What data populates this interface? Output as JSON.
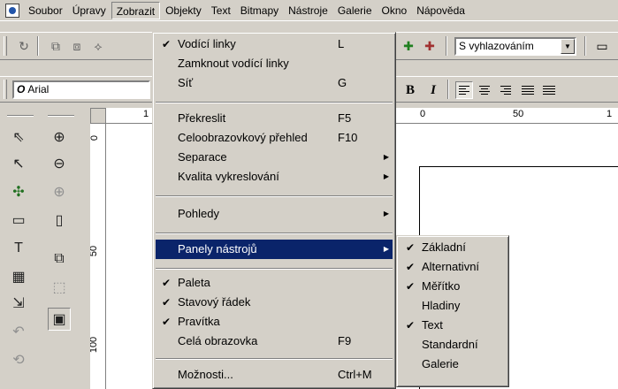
{
  "menubar": {
    "items": [
      "Soubor",
      "Úpravy",
      "Zobrazit",
      "Objekty",
      "Text",
      "Bitmapy",
      "Nástroje",
      "Galerie",
      "Okno",
      "Nápověda"
    ]
  },
  "toolbar": {
    "antialias_combo": "S vyhlazováním"
  },
  "format": {
    "font_combo": "Arial",
    "font_prefix": "O",
    "bold": "B",
    "italic": "I"
  },
  "ruler": {
    "h_labels": [
      "1",
      "0",
      "50",
      "1"
    ],
    "v_labels": [
      "0",
      "50",
      "100"
    ]
  },
  "zobrazit_menu": {
    "items": [
      {
        "label": "Vodící linky",
        "shortcut": "L",
        "checked": "✔"
      },
      {
        "label": "Zamknout vodící linky"
      },
      {
        "label": "Síť",
        "shortcut": "G"
      },
      {
        "label": "Překreslit",
        "shortcut": "F5"
      },
      {
        "label": "Celoobrazovkový přehled",
        "shortcut": "F10"
      },
      {
        "label": "Separace",
        "submenu": "▶"
      },
      {
        "label": "Kvalita vykreslování",
        "submenu": "▶"
      },
      {
        "label": "Pohledy",
        "submenu": "▶"
      },
      {
        "label": "Panely nástrojů",
        "submenu": "▶"
      },
      {
        "label": "Paleta",
        "checked": "✔"
      },
      {
        "label": "Stavový řádek",
        "checked": "✔"
      },
      {
        "label": "Pravítka",
        "checked": "✔"
      },
      {
        "label": "Celá obrazovka",
        "shortcut": "F9"
      },
      {
        "label": "Možnosti...",
        "shortcut": "Ctrl+M"
      }
    ]
  },
  "panely_submenu": {
    "items": [
      {
        "label": "Základní",
        "checked": "✔"
      },
      {
        "label": "Alternativní",
        "checked": "✔"
      },
      {
        "label": "Měřítko",
        "checked": "✔"
      },
      {
        "label": "Hladiny"
      },
      {
        "label": "Text",
        "checked": "✔"
      },
      {
        "label": "Standardní"
      },
      {
        "label": "Galerie"
      }
    ]
  },
  "colors": {
    "highlight": "#0a246a",
    "face": "#d4d0c8"
  }
}
